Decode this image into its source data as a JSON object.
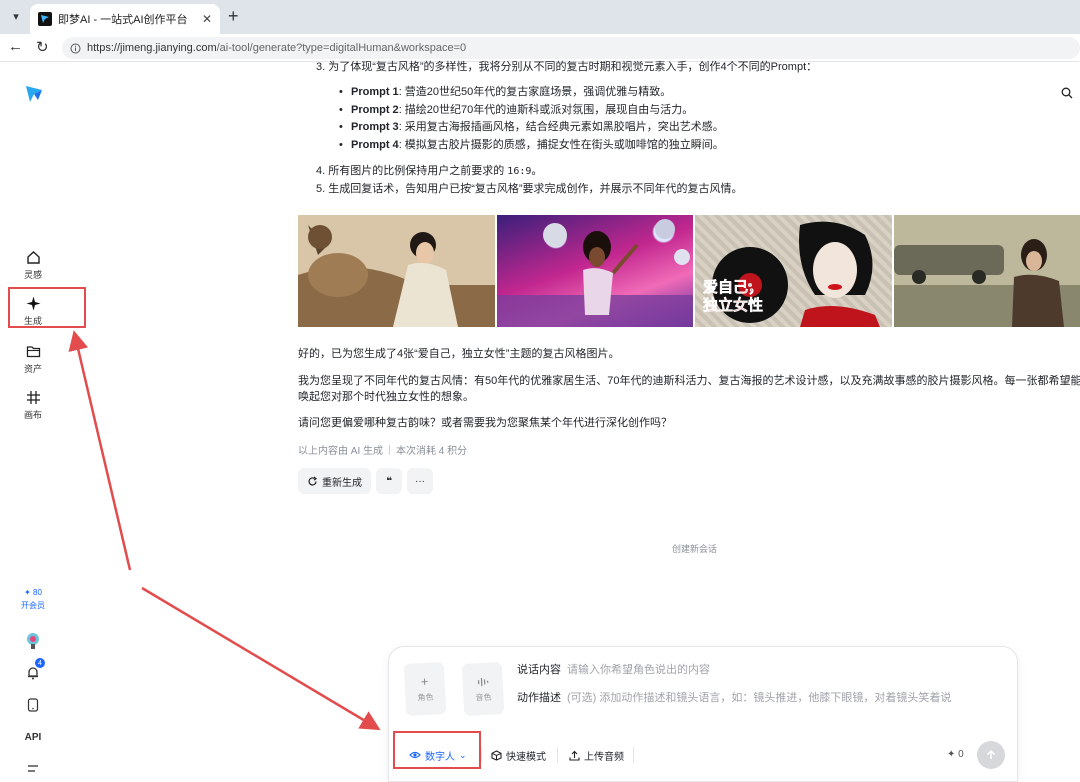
{
  "browser": {
    "tab_title": "即梦AI - 一站式AI创作平台",
    "url_main": "https://jimeng.jianying.com",
    "url_rest": "/ai-tool/generate?type=digitalHuman&workspace=0"
  },
  "sidebar": {
    "items": [
      {
        "label": "灵感",
        "icon": "home-icon"
      },
      {
        "label": "生成",
        "icon": "sparkle-icon"
      },
      {
        "label": "资产",
        "icon": "folder-icon"
      },
      {
        "label": "画布",
        "icon": "canvas-icon"
      }
    ],
    "credits": "✦ 80",
    "vip_label": "开会员",
    "notification_count": "4",
    "api_label": "API"
  },
  "conversation": {
    "step3": "3. 为了体现“复古风格”的多样性，我将分别从不同的复古时期和视觉元素入手，创作4个不同的Prompt：",
    "prompts": [
      {
        "name": "Prompt 1",
        "text": ": 营造20世纪50年代的复古家庭场景，强调优雅与精致。"
      },
      {
        "name": "Prompt 2",
        "text": ": 描绘20世纪70年代的迪斯科或派对氛围，展现自由与活力。"
      },
      {
        "name": "Prompt 3",
        "text": ": 采用复古海报插画风格，结合经典元素如黑胶唱片，突出艺术感。"
      },
      {
        "name": "Prompt 4",
        "text": ": 模拟复古胶片摄影的质感，捕捉女性在街头或咖啡馆的独立瞬间。"
      }
    ],
    "step4_pre": "4. 所有图片的比例保持用户之前要求的 ",
    "step4_ratio": "16:9",
    "step4_post": "。",
    "step5": "5. 生成回复话术，告知用户已按“复古风格”要求完成创作，并展示不同年代的复古风情。",
    "poster_text_line1": "爱自己，",
    "poster_text_line2": "独立女性",
    "reply1": "好的，已为您生成了4张“爱自己，独立女性”主题的复古风格图片。",
    "reply2_line1": "我为您呈现了不同年代的复古风情：有50年代的优雅家居生活、70年代的迪斯科活力、复古海报的艺术设计感，以及充满故事感的胶片摄影风格。每一张都希望能",
    "reply2_line2": "唤起您对那个时代独立女性的想象。",
    "reply3": "请问您更偏爱哪种复古韵味？或者需要我为您聚焦某个年代进行深化创作吗？",
    "meta_ai": "以上内容由 AI 生成",
    "meta_cost": "本次消耗 4 积分",
    "regen_label": "重新生成",
    "quote_label": "❝",
    "more_label": "···",
    "new_session": "创建新会话"
  },
  "composer": {
    "role_card": "角色",
    "audio_card": "音色",
    "speech_key": "说话内容",
    "speech_placeholder": "请输入你希望角色说出的内容",
    "action_key": "动作描述",
    "action_placeholder": "(可选) 添加动作描述和镜头语言，如：镜头推进，他膝下眼镜，对着镜头笑着说",
    "mode_label": "数字人",
    "fast_mode_label": "快速模式",
    "upload_audio_label": "上传音频",
    "credit_cost": "0"
  }
}
